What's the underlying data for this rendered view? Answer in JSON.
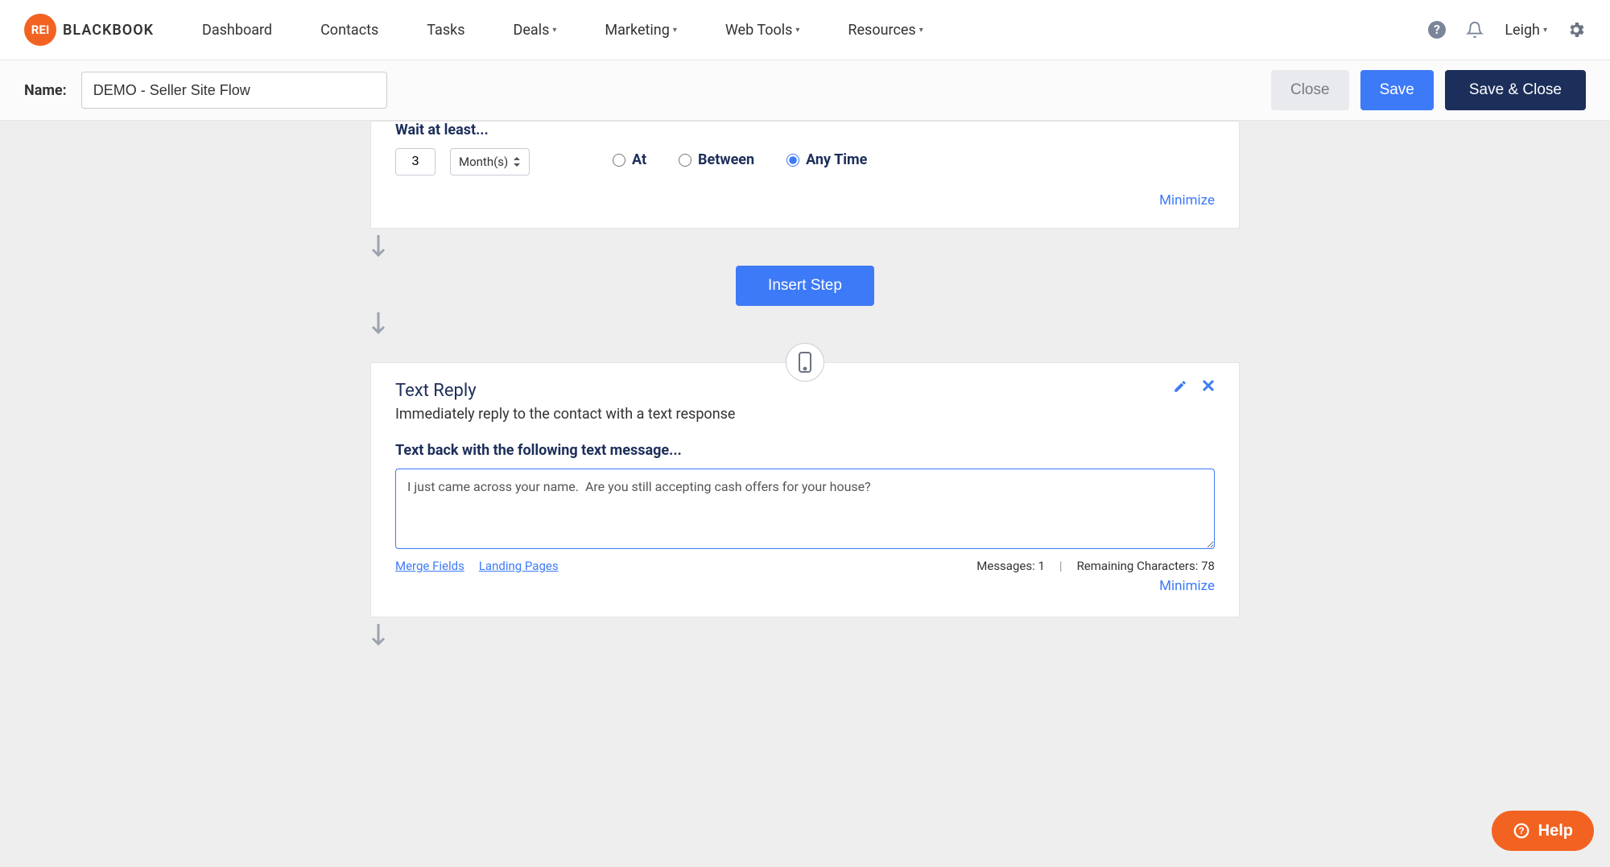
{
  "brand": {
    "badge": "REI",
    "name": "BLACKBOOK"
  },
  "nav": {
    "dashboard": "Dashboard",
    "contacts": "Contacts",
    "tasks": "Tasks",
    "deals": "Deals",
    "marketing": "Marketing",
    "webtools": "Web Tools",
    "resources": "Resources"
  },
  "user": {
    "name": "Leigh"
  },
  "subbar": {
    "name_label": "Name:",
    "name_value": "DEMO - Seller Site Flow",
    "close": "Close",
    "save": "Save",
    "save_close": "Save & Close"
  },
  "wait": {
    "title": "Wait at least...",
    "value": "3",
    "unit": "Month(s)",
    "options": {
      "at": "At",
      "between": "Between",
      "anytime": "Any Time"
    },
    "selected": "anytime",
    "minimize": "Minimize"
  },
  "insert_step": "Insert Step",
  "text_reply": {
    "title": "Text Reply",
    "subtitle": "Immediately reply to the contact with a text response",
    "section_label": "Text back with the following text message...",
    "message": "I just came across your name.  Are you still accepting cash offers for your house?",
    "merge_fields": "Merge Fields",
    "landing_pages": "Landing Pages",
    "messages_label": "Messages:",
    "messages_count": "1",
    "remaining_label": "Remaining Characters:",
    "remaining_count": "78",
    "minimize": "Minimize"
  },
  "help": "Help"
}
